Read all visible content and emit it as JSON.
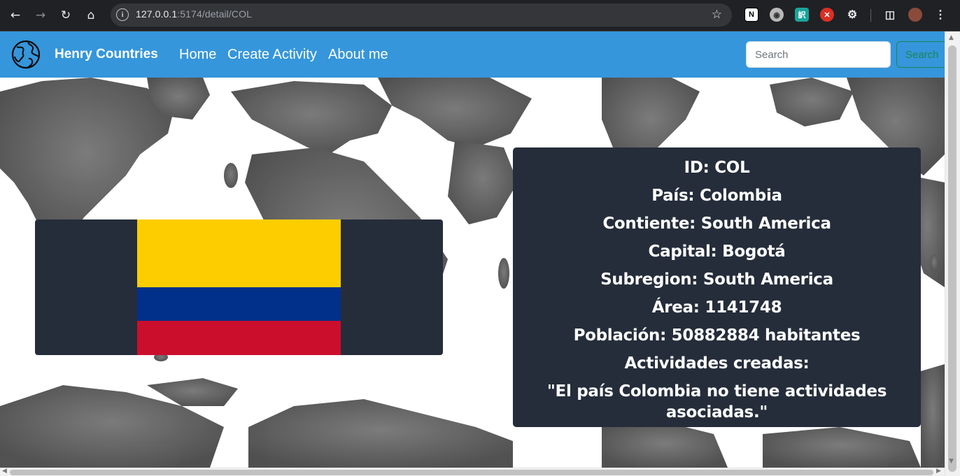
{
  "browser": {
    "url_host": "127.0.0.1",
    "url_path": ":5174/detail/COL",
    "extensions": [
      "notion-icon",
      "owl-icon",
      "translate-icon",
      "blocker-icon",
      "puzzle-icon"
    ]
  },
  "navbar": {
    "brand": "Henry Countries",
    "links": [
      "Home",
      "Create Activity",
      "About me"
    ],
    "search_placeholder": "Search",
    "search_button": "Search",
    "bg_color": "#3596db"
  },
  "country": {
    "flag_colors": [
      "#fdcd00",
      "#00308a",
      "#cc0e2d"
    ],
    "id_line": "ID: COL",
    "name_line": "País: Colombia",
    "continent_line": "Contiente: South America",
    "capital_line": "Capital: Bogotá",
    "subregion_line": "Subregion: South America",
    "area_line": "Área: 1141748",
    "population_line": "Población: 50882884 habitantes",
    "activities_title": "Actividades creadas:",
    "activities_message": "\"El país Colombia no tiene actividades asociadas.\""
  }
}
